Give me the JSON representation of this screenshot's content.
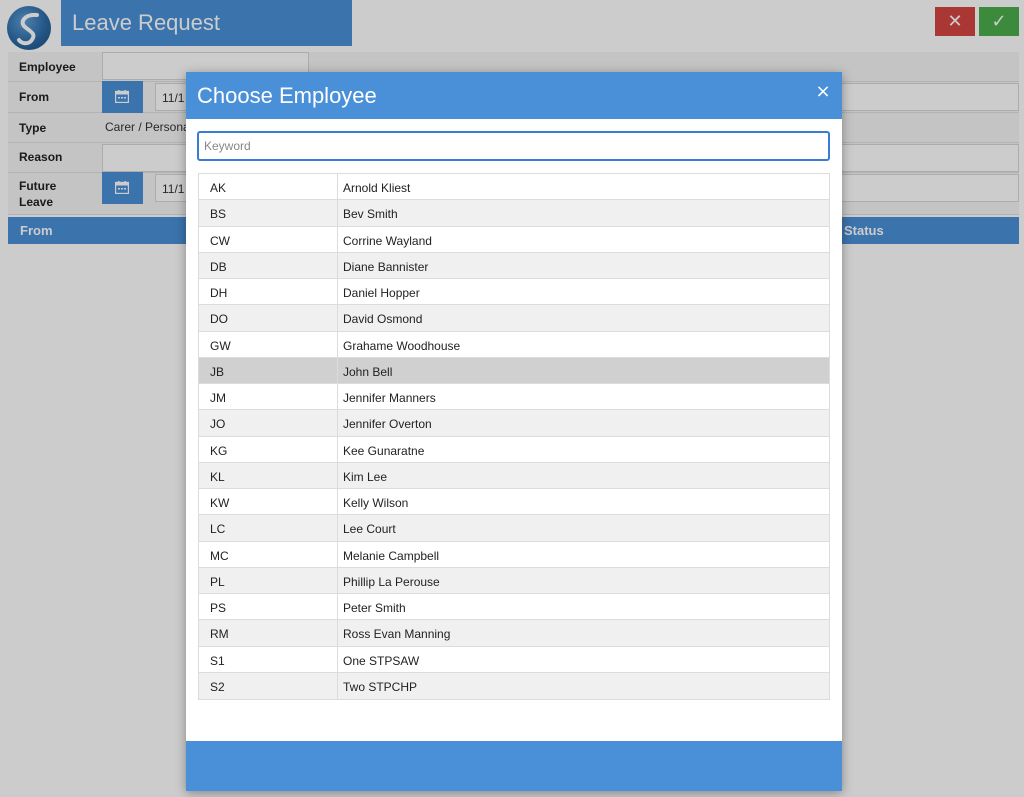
{
  "app": {
    "title": "Leave Request",
    "cancel_icon": "✕",
    "confirm_icon": "✓",
    "accent_color": "#4a90d9"
  },
  "form": {
    "employee_label": "Employee",
    "employee_value": "",
    "from_label": "From",
    "from_value": "11/1",
    "type_label": "Type",
    "type_value": "Carer / Persona",
    "reason_label": "Reason",
    "reason_value": "",
    "future_leave_label_1": "Future",
    "future_leave_label_2": "Leave",
    "future_leave_value": "11/1"
  },
  "grid": {
    "columns": [
      "From",
      "Status"
    ]
  },
  "modal": {
    "title": "Choose Employee",
    "close_icon": "×",
    "search_placeholder": "Keyword",
    "search_value": "",
    "selected_code": "JB",
    "employees": [
      {
        "code": "AK",
        "name": "Arnold Kliest"
      },
      {
        "code": "BS",
        "name": "Bev Smith"
      },
      {
        "code": "CW",
        "name": "Corrine Wayland"
      },
      {
        "code": "DB",
        "name": "Diane Bannister"
      },
      {
        "code": "DH",
        "name": "Daniel Hopper"
      },
      {
        "code": "DO",
        "name": "David Osmond"
      },
      {
        "code": "GW",
        "name": "Grahame Woodhouse"
      },
      {
        "code": "JB",
        "name": "John Bell"
      },
      {
        "code": "JM",
        "name": "Jennifer Manners"
      },
      {
        "code": "JO",
        "name": "Jennifer Overton"
      },
      {
        "code": "KG",
        "name": "Kee Gunaratne"
      },
      {
        "code": "KL",
        "name": "Kim Lee"
      },
      {
        "code": "KW",
        "name": "Kelly Wilson"
      },
      {
        "code": "LC",
        "name": "Lee Court"
      },
      {
        "code": "MC",
        "name": "Melanie Campbell"
      },
      {
        "code": "PL",
        "name": "Phillip La Perouse"
      },
      {
        "code": "PS",
        "name": "Peter Smith"
      },
      {
        "code": "RM",
        "name": "Ross Evan Manning"
      },
      {
        "code": "S1",
        "name": "One STPSAW"
      },
      {
        "code": "S2",
        "name": "Two STPCHP"
      }
    ]
  }
}
